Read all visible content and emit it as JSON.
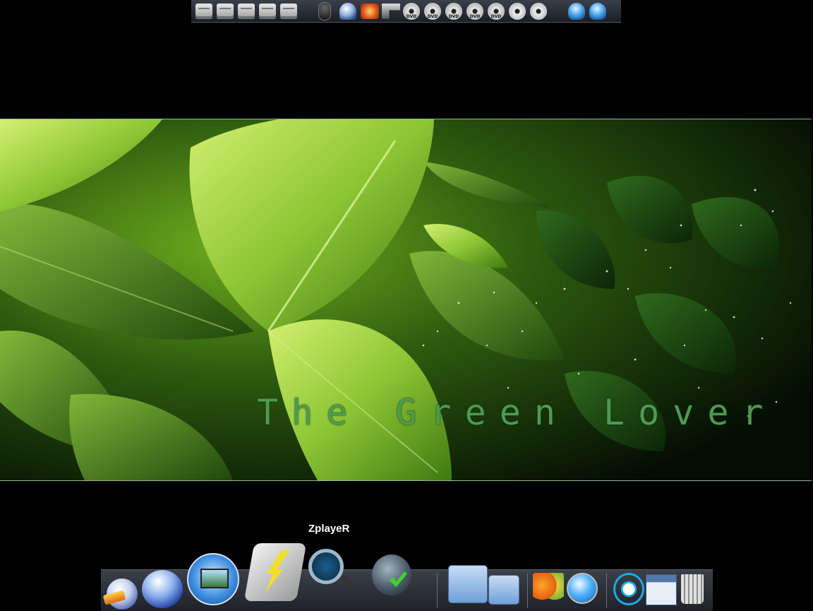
{
  "top_dock": {
    "items": [
      {
        "icon": "hard-drive-icon"
      },
      {
        "icon": "hard-drive-icon"
      },
      {
        "icon": "hard-drive-icon"
      },
      {
        "icon": "hard-drive-icon"
      },
      {
        "icon": "hard-drive-icon"
      },
      {
        "icon": "mouse-icon"
      },
      {
        "icon": "mushroom-icon"
      },
      {
        "icon": "toolbox-icon"
      },
      {
        "icon": "tools-icon"
      },
      {
        "icon": "dvd-disc-icon",
        "label": "DVD"
      },
      {
        "icon": "dvd-disc-icon",
        "label": "DVD"
      },
      {
        "icon": "dvd-disc-icon",
        "label": "DVD"
      },
      {
        "icon": "dvd-disc-icon",
        "label": "DVD"
      },
      {
        "icon": "dvd-disc-icon",
        "label": "DVD"
      },
      {
        "icon": "cd-disc-icon"
      },
      {
        "icon": "cd-disc-icon"
      },
      {
        "icon": "network-globe-icon"
      },
      {
        "icon": "network-globe-icon"
      }
    ]
  },
  "wallpaper": {
    "title": "The Green Lover",
    "accent_color": "#4e9a52"
  },
  "bottom_dock": {
    "tooltip": "ZplayeR",
    "icons": [
      "mail-globe-icon",
      "envelope-globe-icon",
      "display-settings-icon",
      "lightning-launcher-icon",
      "zplayer-icon",
      "check-sphere-icon",
      "folder-icon",
      "folder-small-icon",
      "butterfly-icon",
      "compass-icon",
      "swirl-app-icon",
      "calendar-icon",
      "trash-icon"
    ]
  }
}
